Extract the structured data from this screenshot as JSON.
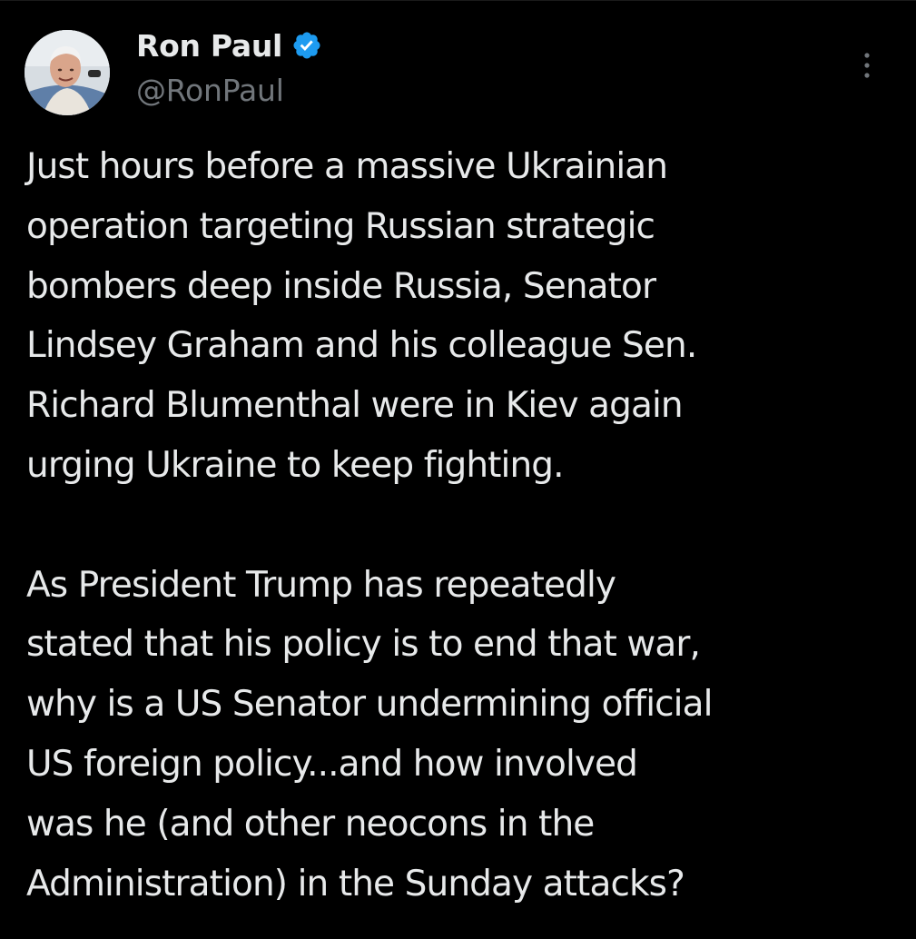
{
  "tweet": {
    "author": {
      "display_name": "Ron Paul",
      "handle": "@RonPaul",
      "verified": true,
      "verified_icon": "verified-badge-icon",
      "avatar_icon": "avatar-photo"
    },
    "more_icon": "more-options-icon",
    "paragraphs": [
      {
        "lines": [
          "Just hours before a massive Ukrainian",
          "operation targeting Russian strategic",
          "bombers deep inside Russia, Senator",
          "Lindsey Graham and his colleague Sen.",
          "Richard Blumenthal were in Kiev again",
          "urging Ukraine to keep fighting."
        ]
      },
      {
        "lines": [
          "As President Trump has repeatedly",
          "stated that his policy is to end that war,",
          "why is a US Senator undermining official",
          "US foreign policy...and how involved",
          "was he (and other neocons in the",
          "Administration) in the Sunday attacks?"
        ]
      }
    ]
  },
  "colors": {
    "background": "#000000",
    "text_primary": "#e7e9ea",
    "text_secondary": "#71767b",
    "verified_blue": "#1d9bf0"
  }
}
